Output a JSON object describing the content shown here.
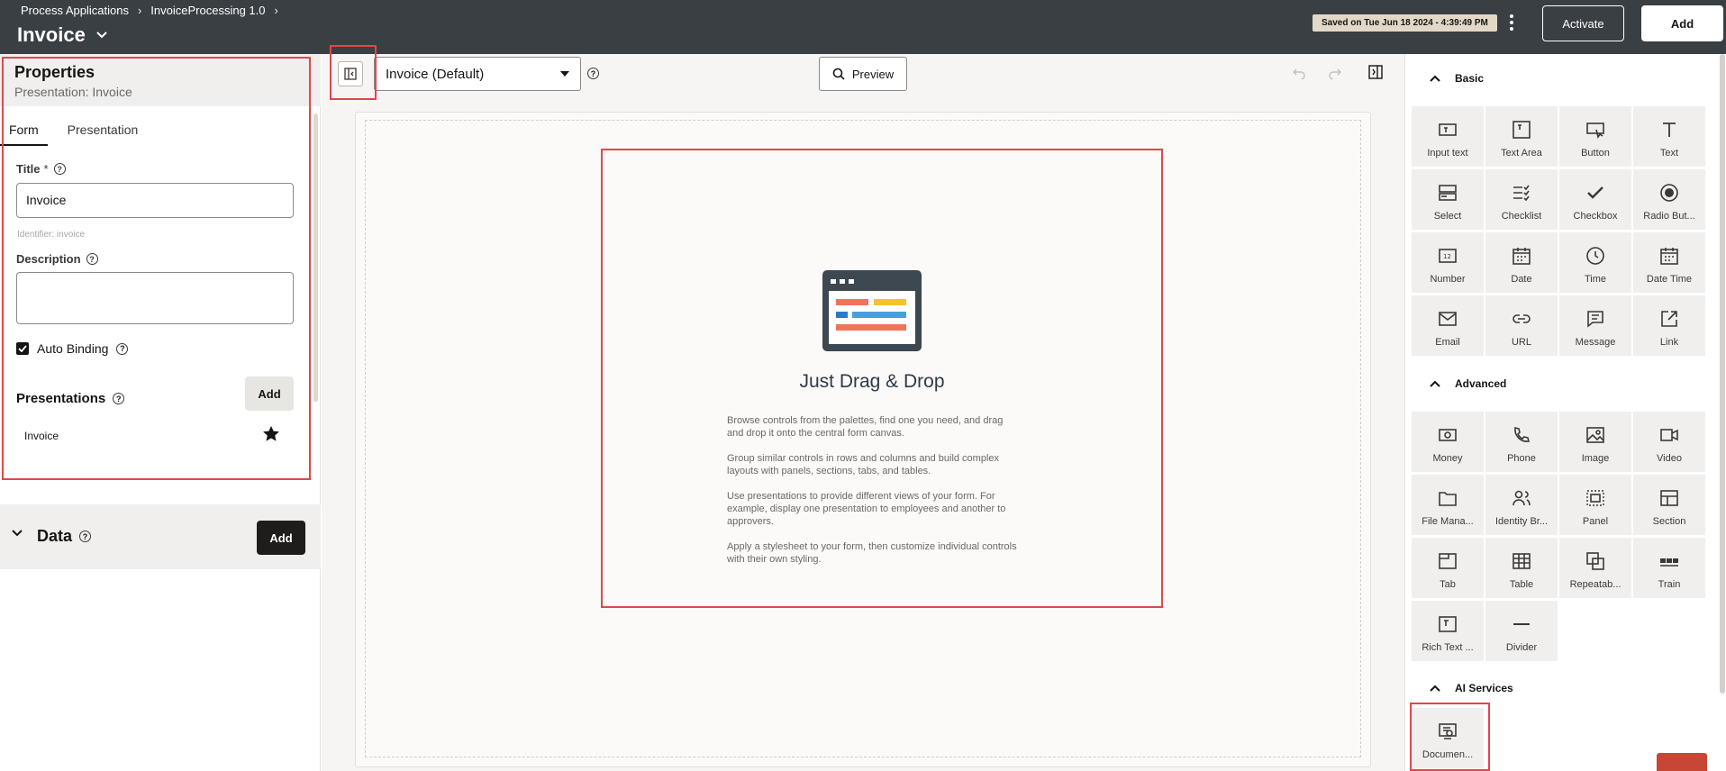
{
  "header": {
    "breadcrumbs": [
      "Process Applications",
      "InvoiceProcessing 1.0"
    ],
    "title": "Invoice",
    "saved_status": "Saved on Tue Jun 18 2024 - 4:39:49 PM",
    "activate_label": "Activate",
    "add_label": "Add"
  },
  "properties": {
    "title": "Properties",
    "subtitle": "Presentation: Invoice",
    "tabs": [
      "Form",
      "Presentation"
    ],
    "active_tab": "Form",
    "title_field": {
      "label": "Title",
      "required_mark": "*",
      "value": "Invoice",
      "hint": "Identifier: invoice"
    },
    "description_field": {
      "label": "Description",
      "value": ""
    },
    "auto_binding": {
      "label": "Auto Binding",
      "checked": true
    },
    "presentations": {
      "label": "Presentations",
      "add_label": "Add",
      "items": [
        "Invoice"
      ]
    }
  },
  "data_section": {
    "title": "Data",
    "add_label": "Add"
  },
  "toolbar": {
    "presentation_select": "Invoice (Default)",
    "preview_label": "Preview"
  },
  "canvas": {
    "title": "Just Drag & Drop",
    "paragraphs": [
      "Browse controls from the palettes, find one you need, and drag and drop it onto the central form canvas.",
      "Group similar controls in rows and columns and build complex layouts with panels, sections, tabs, and tables.",
      "Use presentations to provide different views of your form. For example, display one presentation to employees and another to approvers.",
      "Apply a stylesheet to your form, then customize individual controls with their own styling."
    ]
  },
  "palette": {
    "basic": {
      "title": "Basic",
      "items": [
        {
          "label": "Input text",
          "icon": "input-text-icon"
        },
        {
          "label": "Text Area",
          "icon": "text-area-icon"
        },
        {
          "label": "Button",
          "icon": "button-icon"
        },
        {
          "label": "Text",
          "icon": "text-icon"
        },
        {
          "label": "Select",
          "icon": "select-icon"
        },
        {
          "label": "Checklist",
          "icon": "checklist-icon"
        },
        {
          "label": "Checkbox",
          "icon": "checkbox-icon"
        },
        {
          "label": "Radio But...",
          "icon": "radio-button-icon"
        },
        {
          "label": "Number",
          "icon": "number-icon"
        },
        {
          "label": "Date",
          "icon": "date-icon"
        },
        {
          "label": "Time",
          "icon": "time-icon"
        },
        {
          "label": "Date Time",
          "icon": "date-time-icon"
        },
        {
          "label": "Email",
          "icon": "email-icon"
        },
        {
          "label": "URL",
          "icon": "url-icon"
        },
        {
          "label": "Message",
          "icon": "message-icon"
        },
        {
          "label": "Link",
          "icon": "link-icon"
        }
      ]
    },
    "advanced": {
      "title": "Advanced",
      "items": [
        {
          "label": "Money",
          "icon": "money-icon"
        },
        {
          "label": "Phone",
          "icon": "phone-icon"
        },
        {
          "label": "Image",
          "icon": "image-icon"
        },
        {
          "label": "Video",
          "icon": "video-icon"
        },
        {
          "label": "File Mana...",
          "icon": "file-manager-icon"
        },
        {
          "label": "Identity Br...",
          "icon": "identity-browser-icon"
        },
        {
          "label": "Panel",
          "icon": "panel-icon"
        },
        {
          "label": "Section",
          "icon": "section-icon"
        },
        {
          "label": "Tab",
          "icon": "tab-icon"
        },
        {
          "label": "Table",
          "icon": "table-icon"
        },
        {
          "label": "Repeatab...",
          "icon": "repeatable-icon"
        },
        {
          "label": "Train",
          "icon": "train-icon"
        },
        {
          "label": "Rich Text ...",
          "icon": "rich-text-icon"
        },
        {
          "label": "Divider",
          "icon": "divider-icon"
        }
      ]
    },
    "ai_services": {
      "title": "AI Services",
      "items": [
        {
          "label": "Documen...",
          "icon": "document-ai-icon"
        }
      ]
    }
  },
  "colors": {
    "header_bg": "#3a3f44",
    "highlight": "#e0474c",
    "illustration_dark": "#3d4850"
  }
}
